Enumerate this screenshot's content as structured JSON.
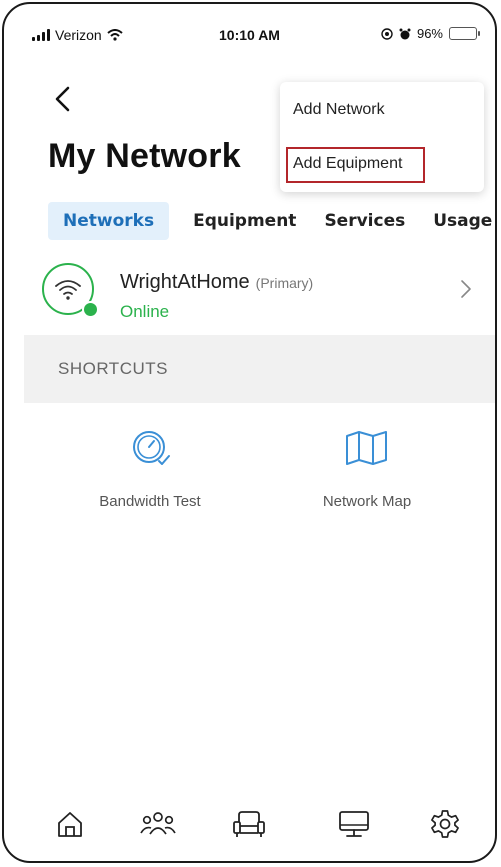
{
  "status_bar": {
    "carrier": "Verizon",
    "time": "10:10 AM",
    "battery": "96%"
  },
  "header": {
    "title": "My Network"
  },
  "menu": {
    "items": [
      {
        "label": "Add Network"
      },
      {
        "label": "Add Equipment",
        "highlighted": true
      }
    ]
  },
  "tabs": [
    {
      "label": "Networks",
      "active": true
    },
    {
      "label": "Equipment"
    },
    {
      "label": "Services"
    },
    {
      "label": "Usage"
    }
  ],
  "network": {
    "name": "WrightAtHome",
    "tag": "(Primary)",
    "status": "Online"
  },
  "shortcuts": {
    "heading": "SHORTCUTS",
    "items": [
      {
        "label": "Bandwidth Test",
        "icon": "speedometer-icon"
      },
      {
        "label": "Network Map",
        "icon": "map-icon"
      }
    ]
  },
  "bottom_nav": {
    "items": [
      {
        "icon": "home-icon"
      },
      {
        "icon": "people-icon"
      },
      {
        "icon": "sofa-icon"
      },
      {
        "icon": "monitor-icon"
      },
      {
        "icon": "settings-icon"
      }
    ]
  },
  "colors": {
    "accent": "#1e6fb8",
    "online": "#2bb24c",
    "highlight_border": "#b3262b",
    "icon_blue": "#3a8fd6"
  }
}
